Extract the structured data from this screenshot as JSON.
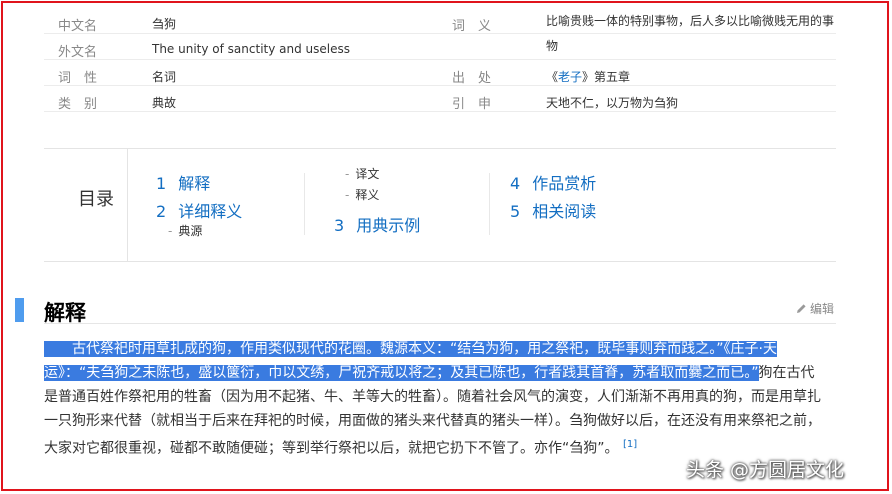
{
  "info": {
    "rows": [
      {
        "l_label": "中文名",
        "l_value": "刍狗",
        "r_label": "词　义",
        "r_value": "比喻贵贱一体的特别事物，后人多以比喻微贱无用的事物"
      },
      {
        "l_label": "外文名",
        "l_value": "The unity of sanctity and useless",
        "r_label": "",
        "r_value": ""
      },
      {
        "l_label": "词　性",
        "l_value": "名词",
        "r_label": "出　处",
        "r_value_pre": "《",
        "r_value_link": "老子",
        "r_value_post": "》第五章"
      },
      {
        "l_label": "类　别",
        "l_value": "典故",
        "r_label": "引　申",
        "r_value": "天地不仁，以万物为刍狗"
      }
    ]
  },
  "toc": {
    "title": "目录",
    "items": [
      {
        "num": "1",
        "label": "解释"
      },
      {
        "num": "2",
        "label": "详细释义"
      },
      {
        "num": "3",
        "label": "用典示例"
      },
      {
        "num": "4",
        "label": "作品赏析"
      },
      {
        "num": "5",
        "label": "相关阅读"
      }
    ],
    "subs": [
      "典源",
      "译文",
      "释义"
    ]
  },
  "section": {
    "title": "解释",
    "edit_label": "编辑",
    "lines": [
      {
        "hl": "　　古代祭祀时用草扎成的狗，作用类似现代的花圈。魏源本义：“结刍为狗，用之祭祀，既毕事则弃而践之。”《庄子·天",
        "rest": ""
      },
      {
        "hl": "运》：“夫刍狗之未陈也，盛以箧衍，巾以文绣，尸祝齐戒以将之；及其已陈也，行者践其首脊，苏者取而爨之而已。”",
        "rest": "狗在古代"
      },
      {
        "hl": "",
        "rest": "是普通百姓作祭祀用的牲畜（因为用不起猪、牛、羊等大的牲畜）。随着社会风气的演变，人们渐渐不再用真的狗，而是用草扎"
      },
      {
        "hl": "",
        "rest": "一只狗形来代替（就相当于后来在拜祀的时候，用面做的猪头来代替真的猪头一样）。刍狗做好以后，在还没有用来祭祀之前，"
      },
      {
        "hl": "",
        "rest": "大家对它都很重视，碰都不敢随便碰；等到举行祭祀以后，就把它扔下不管了。亦作“刍狗”。"
      }
    ],
    "ref": "[1]"
  },
  "watermark": "头条 @方圆居文化"
}
